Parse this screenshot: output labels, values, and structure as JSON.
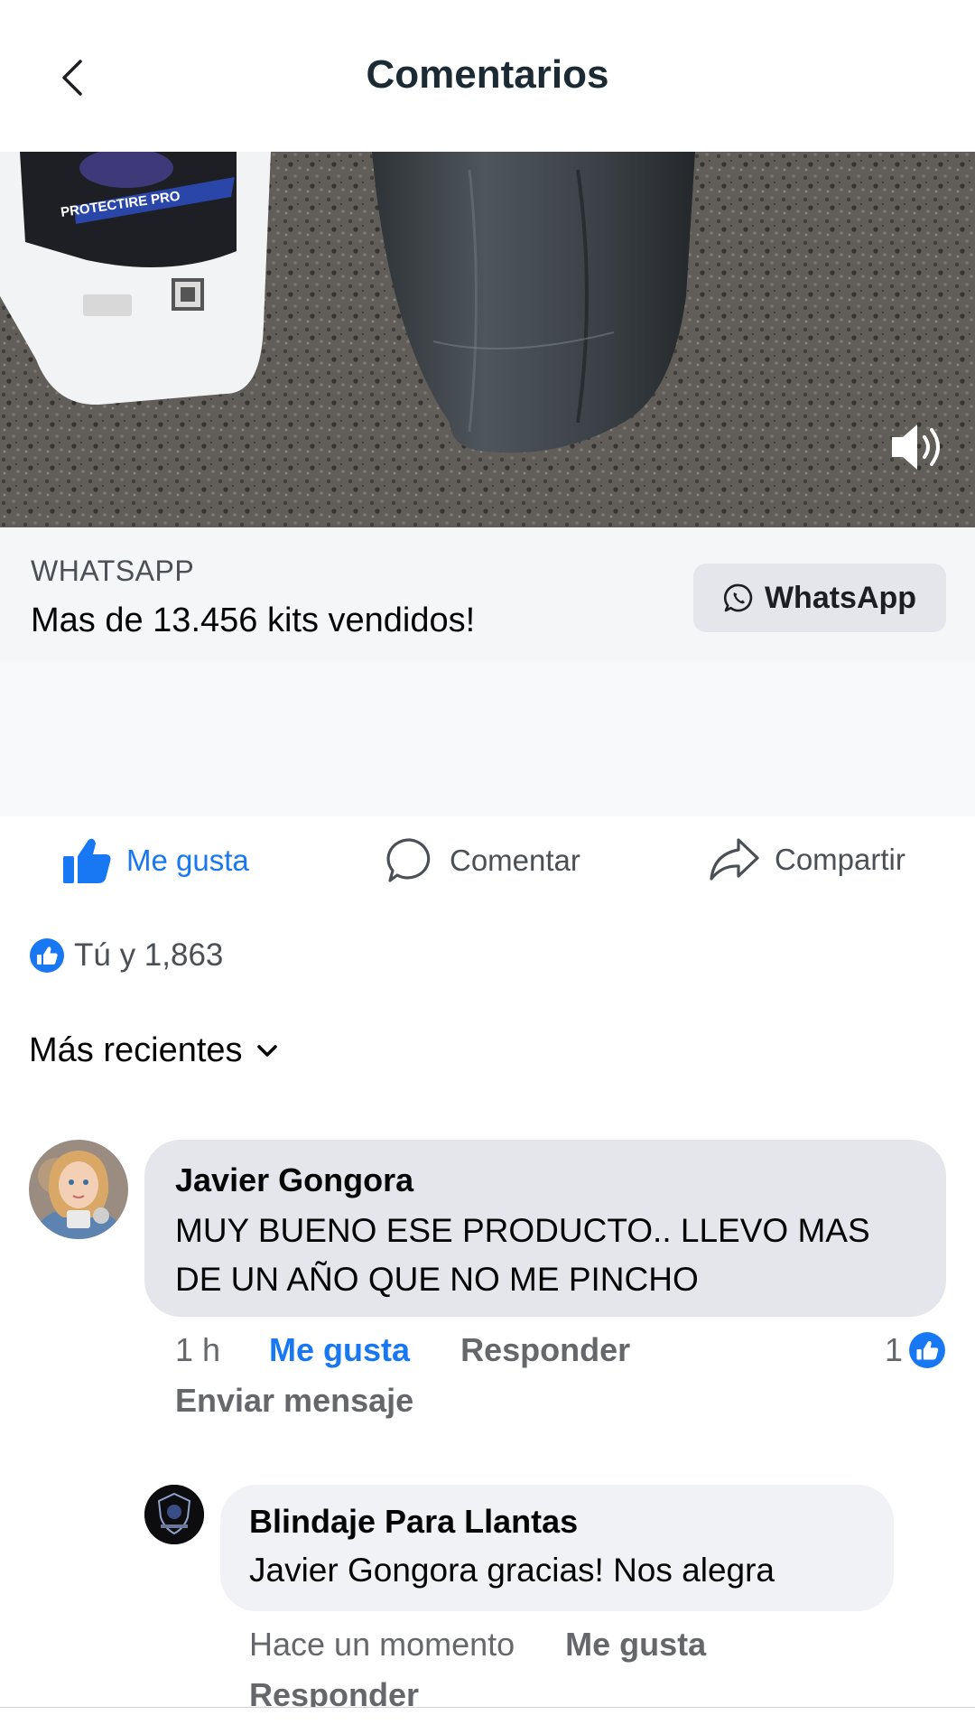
{
  "header": {
    "title": "Comentarios",
    "back_icon": "chevron-left-icon"
  },
  "media": {
    "product_label": "PROTECTIRE PRO",
    "sound_icon": "speaker-icon"
  },
  "ad": {
    "source": "WHATSAPP",
    "headline": "Mas de 13.456 kits vendidos!",
    "button_label": "WhatsApp",
    "button_icon": "whatsapp-icon"
  },
  "actions": {
    "like": "Me gusta",
    "comment": "Comentar",
    "share": "Compartir",
    "like_color": "#1877f2"
  },
  "reactions": {
    "summary": "Tú y 1,863"
  },
  "sort": {
    "label": "Más recientes"
  },
  "comments": [
    {
      "author": "Javier Gongora",
      "text": "MUY BUENO ESE PRODUCTO.. LLEVO MAS DE UN AÑO QUE NO ME PINCHO",
      "time": "1 h",
      "like": "Me gusta",
      "reply": "Responder",
      "like_count": "1",
      "send_message": "Enviar mensaje"
    },
    {
      "author": "Blindaje Para Llantas",
      "text": "Javier Gongora gracias! Nos alegra",
      "time": "Hace un momento",
      "like": "Me gusta",
      "reply": "Responder"
    }
  ]
}
